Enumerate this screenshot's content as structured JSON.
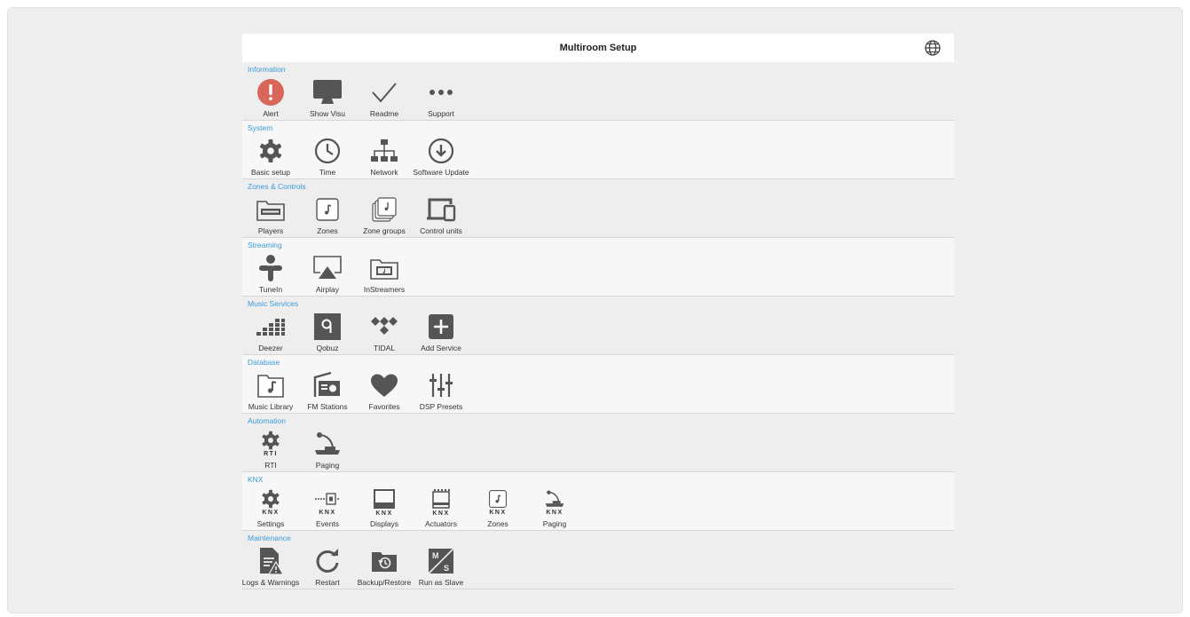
{
  "header": {
    "title": "Multiroom Setup",
    "language_icon": "globe-icon"
  },
  "sections": [
    {
      "title": "Information",
      "items": [
        {
          "label": "Alert",
          "icon": "alert-icon"
        },
        {
          "label": "Show Visu",
          "icon": "monitor-icon"
        },
        {
          "label": "Readme",
          "icon": "checkmark-icon"
        },
        {
          "label": "Support",
          "icon": "more-icon"
        }
      ]
    },
    {
      "title": "System",
      "items": [
        {
          "label": "Basic setup",
          "icon": "gear-icon"
        },
        {
          "label": "Time",
          "icon": "clock-icon"
        },
        {
          "label": "Network",
          "icon": "network-icon"
        },
        {
          "label": "Software Update",
          "icon": "download-icon"
        }
      ]
    },
    {
      "title": "Zones & Controls",
      "items": [
        {
          "label": "Players",
          "icon": "player-device-icon"
        },
        {
          "label": "Zones",
          "icon": "zone-icon"
        },
        {
          "label": "Zone groups",
          "icon": "zone-groups-icon"
        },
        {
          "label": "Control units",
          "icon": "devices-icon"
        }
      ]
    },
    {
      "title": "Streaming",
      "items": [
        {
          "label": "TuneIn",
          "icon": "tunein-icon"
        },
        {
          "label": "Airplay",
          "icon": "airplay-icon"
        },
        {
          "label": "InStreamers",
          "icon": "instreamer-icon"
        }
      ]
    },
    {
      "title": "Music Services",
      "items": [
        {
          "label": "Deezer",
          "icon": "deezer-icon"
        },
        {
          "label": "Qobuz",
          "icon": "qobuz-icon"
        },
        {
          "label": "TIDAL",
          "icon": "tidal-icon"
        },
        {
          "label": "Add Service",
          "icon": "add-icon"
        }
      ]
    },
    {
      "title": "Database",
      "items": [
        {
          "label": "Music Library",
          "icon": "music-library-icon"
        },
        {
          "label": "FM Stations",
          "icon": "radio-icon"
        },
        {
          "label": "Favorites",
          "icon": "heart-icon"
        },
        {
          "label": "DSP Presets",
          "icon": "sliders-icon"
        }
      ]
    },
    {
      "title": "Automation",
      "items": [
        {
          "label": "RTI",
          "icon": "gear-icon",
          "tag": "RTI"
        },
        {
          "label": "Paging",
          "icon": "microphone-icon"
        }
      ]
    },
    {
      "title": "KNX",
      "items": [
        {
          "label": "Settings",
          "icon": "gear-icon",
          "tag": "KNX"
        },
        {
          "label": "Events",
          "icon": "events-icon",
          "tag": "KNX"
        },
        {
          "label": "Displays",
          "icon": "display-icon",
          "tag": "KNX"
        },
        {
          "label": "Actuators",
          "icon": "actuator-icon",
          "tag": "KNX"
        },
        {
          "label": "Zones",
          "icon": "zone-icon",
          "tag": "KNX"
        },
        {
          "label": "Paging",
          "icon": "microphone-icon",
          "tag": "KNX"
        }
      ]
    },
    {
      "title": "Maintenance",
      "items": [
        {
          "label": "Logs & Warnings",
          "icon": "log-warning-icon"
        },
        {
          "label": "Restart",
          "icon": "restart-icon"
        },
        {
          "label": "Backup/Restore",
          "icon": "backup-icon"
        },
        {
          "label": "Run as Slave",
          "icon": "master-slave-icon"
        }
      ]
    }
  ],
  "colors": {
    "accent": "#3a9ad9",
    "icon": "#555555",
    "alert": "#d9665a"
  }
}
